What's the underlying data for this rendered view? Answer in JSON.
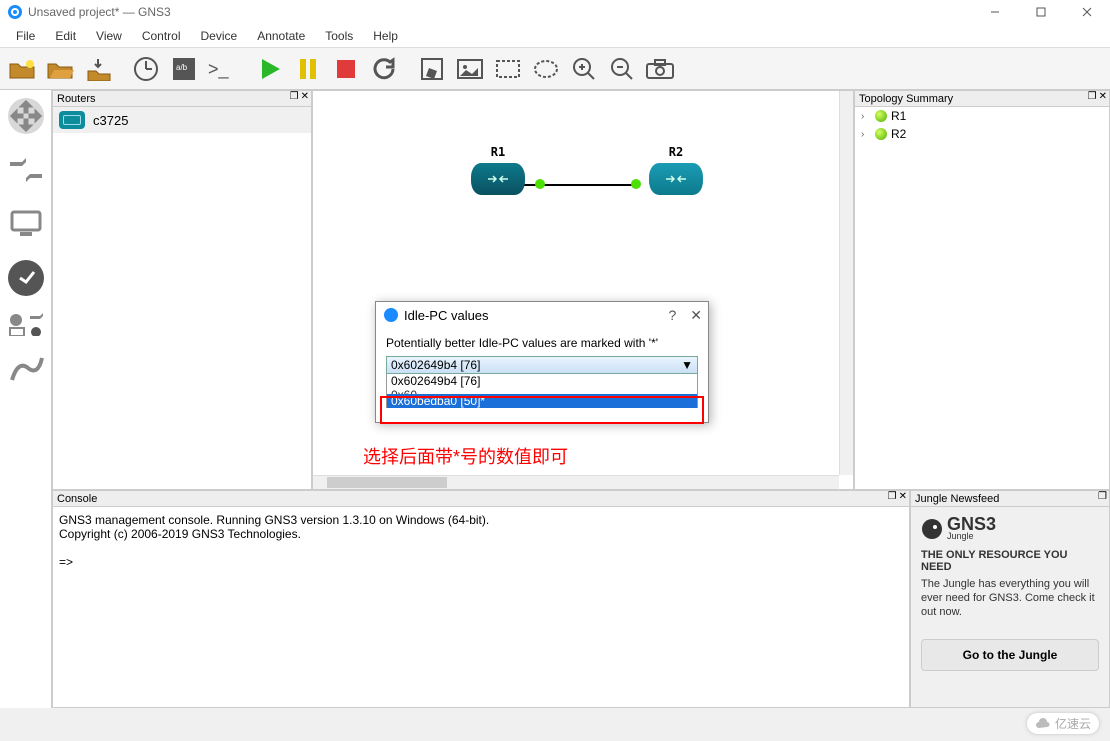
{
  "window": {
    "title": "Unsaved project* — GNS3"
  },
  "menu": {
    "items": [
      "File",
      "Edit",
      "View",
      "Control",
      "Device",
      "Annotate",
      "Tools",
      "Help"
    ]
  },
  "panels": {
    "routers_title": "Routers",
    "topology_title": "Topology Summary",
    "console_title": "Console",
    "jungle_title": "Jungle Newsfeed"
  },
  "routers": {
    "items": [
      {
        "name": "c3725"
      }
    ]
  },
  "topology": {
    "items": [
      {
        "name": "R1"
      },
      {
        "name": "R2"
      }
    ]
  },
  "canvas": {
    "nodes": [
      {
        "id": "R1",
        "label": "R1"
      },
      {
        "id": "R2",
        "label": "R2"
      }
    ],
    "annotation": "选择后面带*号的数值即可"
  },
  "dialog": {
    "title": "Idle-PC values",
    "hint": "Potentially better Idle-PC values are marked with '*'",
    "selected": "0x602649b4 [76]",
    "options": [
      "0x602649b4 [76]",
      "0x60bedba0 [50]*"
    ],
    "partial_option": "0x602649b4 [76]"
  },
  "console": {
    "line1": "GNS3 management console. Running GNS3 version 1.3.10 on Windows (64-bit).",
    "line2": "Copyright (c) 2006-2019 GNS3 Technologies.",
    "prompt": "=>"
  },
  "jungle": {
    "logo_text": "GNS3",
    "logo_sub": "Jungle",
    "headline": "THE ONLY RESOURCE YOU NEED",
    "desc": "The Jungle has everything you will ever need for GNS3. Come check it out now.",
    "button": "Go to the Jungle"
  },
  "watermark": "亿速云"
}
